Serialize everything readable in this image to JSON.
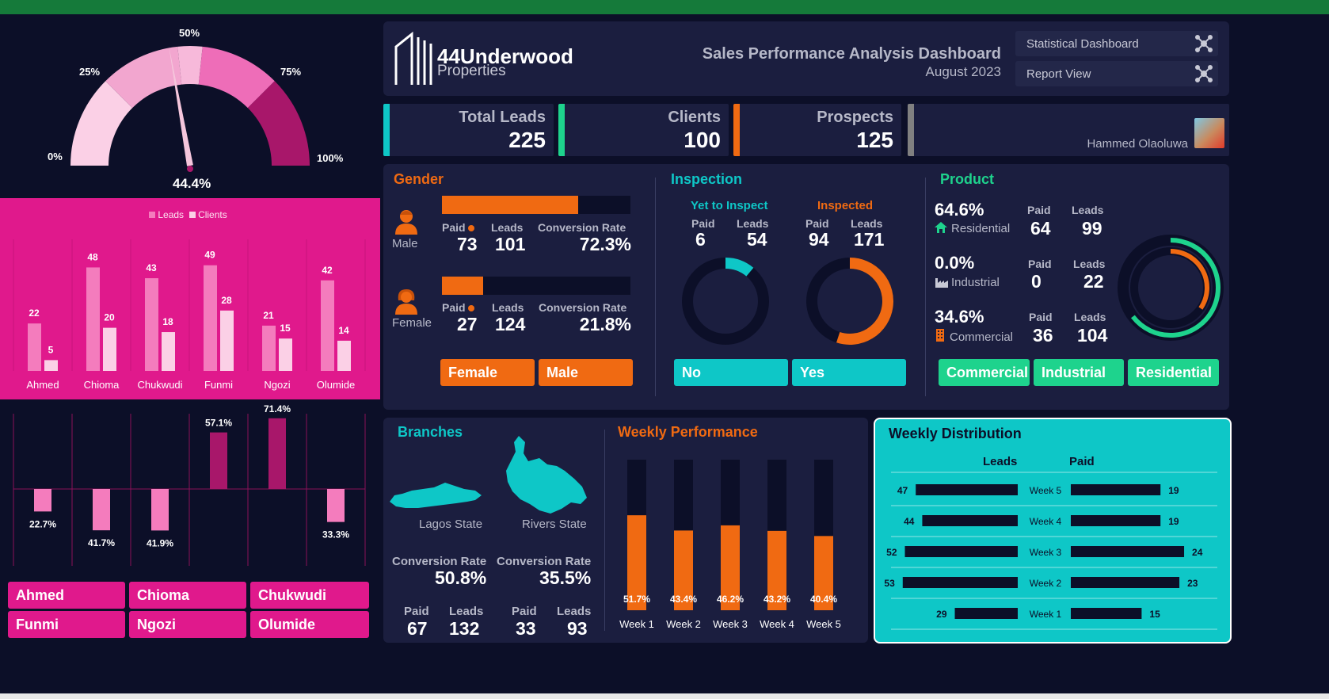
{
  "colors": {
    "green_bar": "#157a3a",
    "navy": "#0c0f28",
    "panel": "#1b1e3f",
    "pink": "#e0198c",
    "orange": "#f06a12",
    "teal": "#0ec7c7",
    "green": "#1ed38d"
  },
  "gauge": {
    "t0": "0%",
    "t25": "25%",
    "t50": "50%",
    "t75": "75%",
    "t100": "100%",
    "value_label": "44.4%",
    "value": 44.4
  },
  "header": {
    "logo_name": "44Underwood",
    "logo_sub": "Properties",
    "title": "Sales Performance Analysis Dashboard",
    "date": "August 2023",
    "nav1": "Statistical Dashboard",
    "nav2": "Report View"
  },
  "kpis": {
    "total_leads_label": "Total Leads",
    "total_leads": "225",
    "clients_label": "Clients",
    "clients": "100",
    "prospects_label": "Prospects",
    "prospects": "125",
    "author": "Hammed Olaoluwa"
  },
  "gender": {
    "title": "Gender",
    "male_label": "Male",
    "female_label": "Female",
    "paid_label": "Paid",
    "leads_label": "Leads",
    "cr_label": "Conversion Rate",
    "male_paid": "73",
    "male_leads": "101",
    "male_cr": "72.3%",
    "male_fill": 0.723,
    "female_paid": "27",
    "female_leads": "124",
    "female_cr": "21.8%",
    "female_fill": 0.218,
    "slicer_female": "Female",
    "slicer_male": "Male"
  },
  "inspection": {
    "title": "Inspection",
    "yet_label": "Yet to Inspect",
    "insp_label": "Inspected",
    "paid_label": "Paid",
    "leads_label": "Leads",
    "yet_paid": "6",
    "yet_leads": "54",
    "insp_paid": "94",
    "insp_leads": "171",
    "yet_fill": 0.111,
    "insp_fill": 0.55,
    "slicer_no": "No",
    "slicer_yes": "Yes"
  },
  "product": {
    "title": "Product",
    "paid_label": "Paid",
    "leads_label": "Leads",
    "residential_pct": "64.6%",
    "residential_label": "Residential",
    "residential_paid": "64",
    "residential_leads": "99",
    "industrial_pct": "0.0%",
    "industrial_label": "Industrial",
    "industrial_paid": "0",
    "industrial_leads": "22",
    "commercial_pct": "34.6%",
    "commercial_label": "Commercial",
    "commercial_paid": "36",
    "commercial_leads": "104",
    "ring_outer": 0.646,
    "ring_inner": 0.346,
    "slicer_commercial": "Commercial",
    "slicer_industrial": "Industrial",
    "slicer_residential": "Residential"
  },
  "branches": {
    "title": "Branches",
    "lagos_label": "Lagos State",
    "rivers_label": "Rivers State",
    "cr_label": "Conversion Rate",
    "lagos_cr": "50.8%",
    "rivers_cr": "35.5%",
    "paid_label": "Paid",
    "leads_label": "Leads",
    "lagos_paid": "67",
    "lagos_leads": "132",
    "rivers_paid": "33",
    "rivers_leads": "93"
  },
  "weekly_perf": {
    "title": "Weekly Performance",
    "weeks": [
      "Week 1",
      "Week 2",
      "Week 3",
      "Week 4",
      "Week 5"
    ],
    "values": [
      51.7,
      43.4,
      46.2,
      43.2,
      40.4
    ],
    "labels": [
      "51.7%",
      "43.4%",
      "46.2%",
      "43.2%",
      "40.4%"
    ]
  },
  "weekly_dist": {
    "title": "Weekly Distribution",
    "leads_header": "Leads",
    "paid_header": "Paid",
    "weeks": [
      "Week 5",
      "Week 4",
      "Week 3",
      "Week 2",
      "Week 1"
    ],
    "leads": [
      47,
      44,
      52,
      53,
      29
    ],
    "paid": [
      19,
      19,
      24,
      23,
      15
    ]
  },
  "agents": {
    "legend_leads": "Leads",
    "legend_clients": "Clients",
    "names": [
      "Ahmed",
      "Chioma",
      "Chukwudi",
      "Funmi",
      "Ngozi",
      "Olumide"
    ],
    "leads": [
      22,
      48,
      43,
      49,
      21,
      42
    ],
    "clients": [
      5,
      20,
      18,
      28,
      15,
      14
    ],
    "conv": [
      -22.7,
      -41.7,
      -41.9,
      57.1,
      71.4,
      -33.3
    ],
    "conv_labels": [
      "22.7%",
      "41.7%",
      "41.9%",
      "57.1%",
      "71.4%",
      "33.3%"
    ]
  },
  "chart_data": [
    {
      "type": "bar",
      "title": "",
      "categories": [
        "Ahmed",
        "Chioma",
        "Chukwudi",
        "Funmi",
        "Ngozi",
        "Olumide"
      ],
      "series": [
        {
          "name": "Leads",
          "values": [
            22,
            48,
            43,
            49,
            21,
            42
          ]
        },
        {
          "name": "Clients",
          "values": [
            5,
            20,
            18,
            28,
            15,
            14
          ]
        }
      ],
      "legend": "top"
    },
    {
      "type": "bar",
      "title": "",
      "categories": [
        "Ahmed",
        "Chioma",
        "Chukwudi",
        "Funmi",
        "Ngozi",
        "Olumide"
      ],
      "values": [
        22.7,
        41.7,
        41.9,
        57.1,
        71.4,
        33.3
      ]
    },
    {
      "type": "bar",
      "title": "Weekly Performance",
      "categories": [
        "Week 1",
        "Week 2",
        "Week 3",
        "Week 4",
        "Week 5"
      ],
      "values": [
        51.7,
        43.4,
        46.2,
        43.2,
        40.4
      ],
      "ylim": [
        0,
        100
      ]
    },
    {
      "type": "bar",
      "title": "Weekly Distribution",
      "categories": [
        "Week 5",
        "Week 4",
        "Week 3",
        "Week 2",
        "Week 1"
      ],
      "series": [
        {
          "name": "Leads",
          "values": [
            47,
            44,
            52,
            53,
            29
          ]
        },
        {
          "name": "Paid",
          "values": [
            19,
            19,
            24,
            23,
            15
          ]
        }
      ]
    }
  ]
}
